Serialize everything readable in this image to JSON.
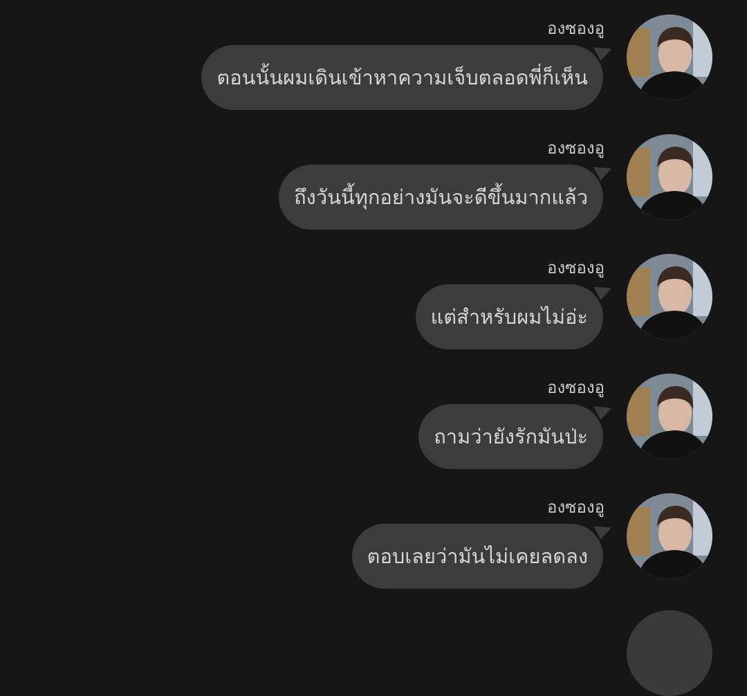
{
  "messages": [
    {
      "sender": "องซองอู",
      "text": "ตอนนั้นผมเดินเข้าหาความเจ็บตลอดพี่ก็เห็น"
    },
    {
      "sender": "องซองอู",
      "text": "ถึงวันนี้ทุกอย่างมันจะดีขึ้นมากแล้ว"
    },
    {
      "sender": "องซองอู",
      "text": "แต่สำหรับผมไม่อ่ะ"
    },
    {
      "sender": "องซองอู",
      "text": "ถามว่ายังรักมันป่ะ"
    },
    {
      "sender": "องซองอู",
      "text": "ตอบเลยว่ามันไม่เคยลดลง"
    }
  ],
  "theme": {
    "background": "#161616",
    "bubble": "#3c3c3c",
    "text": "#d6d6d6",
    "sender_text": "#c9c9c9"
  }
}
